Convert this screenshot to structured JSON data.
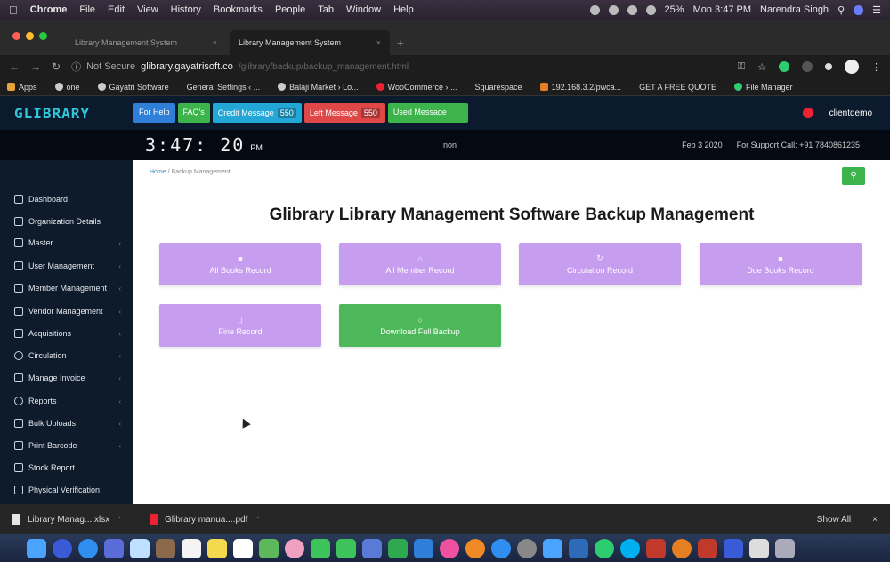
{
  "menubar": {
    "app": "Chrome",
    "items": [
      "File",
      "Edit",
      "View",
      "History",
      "Bookmarks",
      "People",
      "Tab",
      "Window",
      "Help"
    ],
    "battery": "25%",
    "clock": "Mon 3:47 PM",
    "user": "Narendra Singh"
  },
  "tabs": [
    {
      "label": "Library Management System",
      "active": false
    },
    {
      "label": "Library Management System",
      "active": true
    }
  ],
  "address": {
    "security": "Not Secure",
    "host": "glibrary.gayatrisoft.co",
    "path": "/glibrary/backup/backup_management.html"
  },
  "bookmarks": [
    "Apps",
    "one",
    "Gayatri Software",
    "General Settings ‹ ...",
    "Balaji Market › Lo...",
    "WooCommerce › ...",
    "Squarespace",
    "192.168.3.2/pwca...",
    "GET A FREE QUOTE",
    "File Manager"
  ],
  "app": {
    "logo": "GLIBRARY",
    "buttons": [
      {
        "label": "For Help",
        "count": "",
        "color": "#2f7fd8"
      },
      {
        "label": "FAQ's",
        "count": "",
        "color": "#3cb44b"
      },
      {
        "label": "Credit Message",
        "count": "550",
        "color": "#22a7d6"
      },
      {
        "label": "Left Message",
        "count": "550",
        "color": "#e04848"
      },
      {
        "label": "Used Message",
        "count": "",
        "color": "#3cb44b"
      }
    ],
    "username": "clientdemo"
  },
  "timebar": {
    "clock": "3:47: 20",
    "ampm": "PM",
    "user": "non",
    "date": "Feb 3 2020",
    "support": "For Support Call: +91 7840861235"
  },
  "sidebar": [
    "Dashboard",
    "Organization Details",
    "Master",
    "User Management",
    "Member Management",
    "Vendor Management",
    "Acquisitions",
    "Circulation",
    "Manage Invoice",
    "Reports",
    "Bulk Uploads",
    "Print Barcode",
    "Stock Report",
    "Physical Verification"
  ],
  "main": {
    "breadcrumb_home": "Home",
    "breadcrumb_sep": "/",
    "breadcrumb_current": "Backup Management",
    "title": "Glibrary Library Management Software Backup Management",
    "cards": [
      {
        "label": "All Books Record",
        "icon": "book-icon",
        "glyph": "■"
      },
      {
        "label": "All Member Record",
        "icon": "user-icon",
        "glyph": "⌂"
      },
      {
        "label": "Circulation Record",
        "icon": "refresh-icon",
        "glyph": "↻"
      },
      {
        "label": "Due Books Record",
        "icon": "book-icon",
        "glyph": "■"
      },
      {
        "label": "Fine Record",
        "icon": "file-icon",
        "glyph": "▯"
      },
      {
        "label": "Download Full Backup",
        "icon": "download-icon",
        "glyph": "○"
      }
    ]
  },
  "downloads": [
    {
      "name": "Library Manag....xlsx",
      "type": "xlsx"
    },
    {
      "name": "Glibrary manua....pdf",
      "type": "pdf"
    }
  ],
  "downloads_showall": "Show All",
  "colors": {
    "card_purple": "#c79df0",
    "card_green": "#4cb85a",
    "sidebar_bg": "#0d1b2a",
    "header_bg": "#0b1a2c"
  }
}
